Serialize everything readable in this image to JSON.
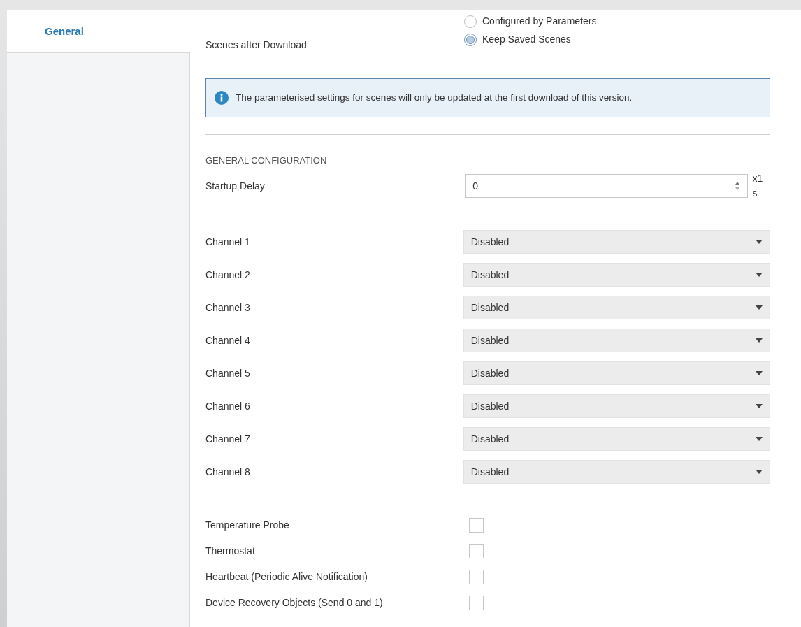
{
  "sidebar": {
    "items": [
      {
        "label": "General",
        "selected": true
      }
    ]
  },
  "scenes_after_download": {
    "label": "Scenes after Download",
    "options": [
      {
        "label": "Configured by Parameters",
        "selected": false
      },
      {
        "label": "Keep Saved Scenes",
        "selected": true
      }
    ]
  },
  "info": {
    "text": "The parameterised settings for scenes will only be updated at the first download of this version."
  },
  "general_configuration": {
    "heading": "GENERAL CONFIGURATION",
    "startup_delay": {
      "label": "Startup Delay",
      "value": "0",
      "unit": "x1 s"
    }
  },
  "channels": [
    {
      "label": "Channel 1",
      "value": "Disabled"
    },
    {
      "label": "Channel 2",
      "value": "Disabled"
    },
    {
      "label": "Channel 3",
      "value": "Disabled"
    },
    {
      "label": "Channel 4",
      "value": "Disabled"
    },
    {
      "label": "Channel 5",
      "value": "Disabled"
    },
    {
      "label": "Channel 6",
      "value": "Disabled"
    },
    {
      "label": "Channel 7",
      "value": "Disabled"
    },
    {
      "label": "Channel 8",
      "value": "Disabled"
    }
  ],
  "options": [
    {
      "label": "Temperature Probe",
      "checked": false
    },
    {
      "label": "Thermostat",
      "checked": false
    },
    {
      "label": "Heartbeat (Periodic Alive Notification)",
      "checked": false
    },
    {
      "label": "Device Recovery Objects (Send 0 and 1)",
      "checked": false
    }
  ]
}
